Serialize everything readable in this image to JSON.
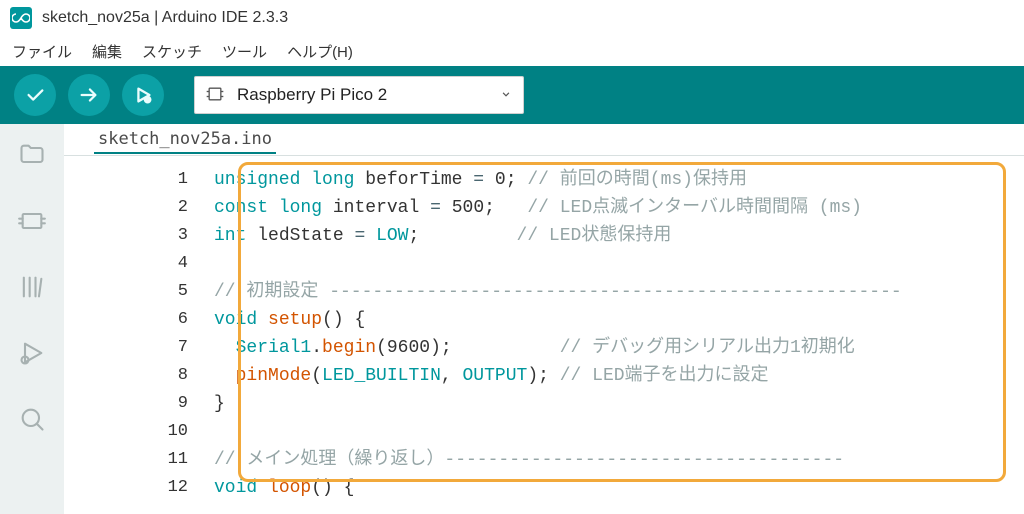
{
  "window": {
    "title": "sketch_nov25a | Arduino IDE 2.3.3"
  },
  "menu": {
    "file": "ファイル",
    "edit": "編集",
    "sketch": "スケッチ",
    "tools": "ツール",
    "help": "ヘルプ(H)"
  },
  "board": {
    "name": "Raspberry Pi Pico 2"
  },
  "tab": {
    "label": "sketch_nov25a.ino"
  },
  "code": {
    "1": {
      "ln": "1",
      "a": "unsigned",
      "b": "long",
      "c": "beforTime",
      "d": "=",
      "e": "0",
      "f": ";",
      "cmt": "// 前回の時間(ms)保持用"
    },
    "2": {
      "ln": "2",
      "a": "const",
      "b": "long",
      "c": "interval",
      "d": "=",
      "e": "500",
      "f": ";",
      "cmt": "// LED点滅インターバル時間間隔 (ms)"
    },
    "3": {
      "ln": "3",
      "a": "int",
      "b": "ledState",
      "c": "=",
      "d": "LOW",
      "e": ";",
      "cmt": "// LED状態保持用"
    },
    "4": {
      "ln": "4"
    },
    "5": {
      "ln": "5",
      "cmt": "// 初期設定 -----------------------------------------------------"
    },
    "6": {
      "ln": "6",
      "a": "void",
      "b": "setup",
      "c": "()",
      "d": " {"
    },
    "7": {
      "ln": "7",
      "a": "Serial1",
      "b": ".",
      "c": "begin",
      "d": "(",
      "e": "9600",
      "f": ");",
      "cmt": "// デバッグ用シリアル出力1初期化"
    },
    "8": {
      "ln": "8",
      "a": "pinMode",
      "b": "(",
      "c": "LED_BUILTIN",
      "d": ",",
      "e": "OUTPUT",
      "f": ");",
      "cmt": "// LED端子を出力に設定"
    },
    "9": {
      "ln": "9",
      "a": "}"
    },
    "10": {
      "ln": "10"
    },
    "11": {
      "ln": "11",
      "cmt": "// メイン処理（繰り返し）-------------------------------------"
    },
    "12": {
      "ln": "12",
      "a": "void",
      "b": "loop",
      "c": "()",
      "d": " {"
    }
  }
}
